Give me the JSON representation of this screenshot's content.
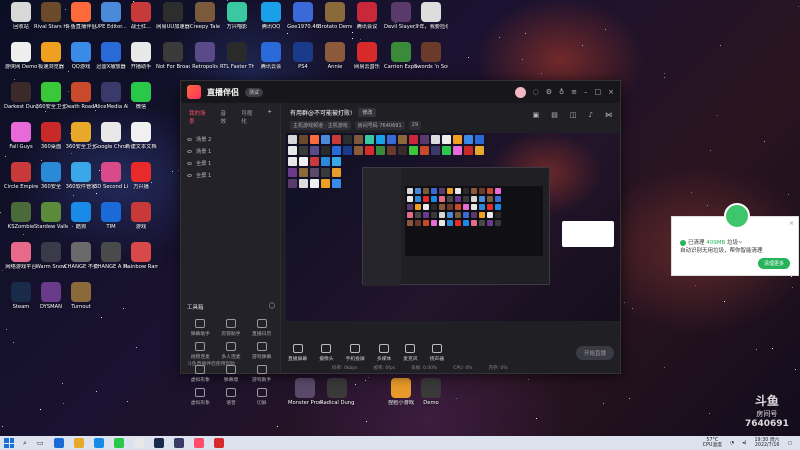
{
  "desktop_icons": [
    {
      "label": "回收站",
      "color": "#d8d8d8"
    },
    {
      "label": "Rival Stars Horse Ra...",
      "color": "#6a4a2a"
    },
    {
      "label": "斗鱼直播伴侣",
      "color": "#ff6a3d"
    },
    {
      "label": "UPE Editor...",
      "color": "#4a8ad8"
    },
    {
      "label": "战士红...",
      "color": "#c83a3a"
    },
    {
      "label": "网易UU加速器",
      "color": "#2d2d2d"
    },
    {
      "label": "Creepy Tale",
      "color": "#7a5a3a"
    },
    {
      "label": "万兴喵影",
      "color": "#3ac8a0"
    },
    {
      "label": "腾讯QQ",
      "color": "#1aa0e8"
    },
    {
      "label": "Gee1970.46",
      "color": "#3a6ad8"
    },
    {
      "label": "Brotato Demo",
      "color": "#8a6a3a"
    },
    {
      "label": "腾讯会议",
      "color": "#c8283a"
    },
    {
      "label": "Devil Slayer Raksasi",
      "color": "#5a3a6a"
    },
    {
      "label": "少年，我要捡垃圾",
      "color": "#ddd"
    },
    {
      "label": "游侠网 Demo",
      "color": "#eee"
    },
    {
      "label": "极速浏览器",
      "color": "#f0a020"
    },
    {
      "label": "QQ游戏",
      "color": "#3a8ae8"
    },
    {
      "label": "迅雷X播放器",
      "color": "#2a6ad8"
    },
    {
      "label": "开播助手",
      "color": "#e8e8e8"
    },
    {
      "label": "Not For Broadcast",
      "color": "#3a3a3a"
    },
    {
      "label": "Retropolis",
      "color": "#5a4a8a"
    },
    {
      "label": "RTL Faster Than Light",
      "color": "#2a2a2a"
    },
    {
      "label": "腾讯云会",
      "color": "#2a6ad8"
    },
    {
      "label": "PS4",
      "color": "#1a3a8a"
    },
    {
      "label": "Annie",
      "color": "#8a5a3a"
    },
    {
      "label": "网易云音乐",
      "color": "#d82a2a"
    },
    {
      "label": "Carrion Expedition",
      "color": "#3a8a3a"
    },
    {
      "label": "Swords 'n Souls Ne...",
      "color": "#6a3a2a"
    },
    {
      "label": "Darkest Dungeon",
      "color": "#3a2a2a"
    },
    {
      "label": "360安全卫士",
      "color": "#3ac83a"
    },
    {
      "label": "Death Road to Canada",
      "color": "#c84a2a"
    },
    {
      "label": "AliceMedia AIGCentral",
      "color": "#3a3a6a"
    },
    {
      "label": "微信",
      "color": "#2ac84a"
    },
    {
      "label": "Fall Guys",
      "color": "#e86ad8"
    },
    {
      "label": "360桌面",
      "color": "#c82a2a"
    },
    {
      "label": "360安全卫士",
      "color": "#e8a82a"
    },
    {
      "label": "Google Chrome",
      "color": "#e8e8e8"
    },
    {
      "label": "新建文本文档",
      "color": "#f0f0f0"
    },
    {
      "label": "Circle Empires",
      "color": "#c83a3a"
    },
    {
      "label": "360安全",
      "color": "#2a8ad8"
    },
    {
      "label": "360软件管家",
      "color": "#3aa8e8"
    },
    {
      "label": "3D Second Life",
      "color": "#d84a8a"
    },
    {
      "label": "万兴播",
      "color": "#e82a2a"
    },
    {
      "label": "KSZombie",
      "color": "#4a6a3a"
    },
    {
      "label": "Stardew Valley",
      "color": "#5a8a3a"
    },
    {
      "label": "酷狗",
      "color": "#1a8ae8"
    },
    {
      "label": "TIM",
      "color": "#1a6ad8"
    },
    {
      "label": "游戏",
      "color": "#c83a3a"
    },
    {
      "label": "网络游戏平台",
      "color": "#e86a8a"
    },
    {
      "label": "Warm Snow",
      "color": "#3a3a4a"
    },
    {
      "label": "CHANGE 不要可怜",
      "color": "#6a6a6a"
    },
    {
      "label": "CHANGE A Homeles...",
      "color": "#4a4a4a"
    },
    {
      "label": "Rainbow Rampage",
      "color": "#d84a4a"
    },
    {
      "label": "Steam",
      "color": "#1a2a4a"
    },
    {
      "label": "DYSMAN",
      "color": "#6a3a8a"
    },
    {
      "label": "Turnout",
      "color": "#8a6a3a"
    },
    {
      "label": "Monster Prom",
      "color": "#5a4a6a"
    },
    {
      "label": "Radical Dunge...",
      "color": "#3a3a3a"
    },
    {
      "label": "捏脸小游戏",
      "color": "#e89a2a"
    },
    {
      "label": "Demo",
      "color": "#3a3a3a"
    }
  ],
  "app": {
    "name": "直播伴侣",
    "badge": "测试",
    "sidebar_tabs": [
      "我的场景",
      "音效",
      "可视化"
    ],
    "scenes": [
      "场景 2",
      "场景 1",
      "全屏 1",
      "全屏 1"
    ],
    "tools_title": "工具箱",
    "tools": [
      "弹幕助手",
      "房管助手",
      "直播日历",
      "视频连麦",
      "多人连麦",
      "游戏弹幕",
      "虚拟形象",
      "弹幕墙",
      "游戏助手",
      "虚拟形象",
      "语音",
      "切屏"
    ],
    "sidebar_footer": "斗鱼直播伴侣使用帮助",
    "live_title": "有用群@不可能被打败!",
    "edit_label": "修改",
    "meta": [
      "主机游戏频道 · 主机游戏",
      "房间号码 7640691",
      "29"
    ],
    "bottom_controls": [
      "直播屏幕",
      "摄像头",
      "手机投屏",
      "多媒体",
      "麦克风",
      "扬声器"
    ],
    "start_label": "开始直播",
    "status": [
      "码率: 0kbps",
      "帧率: 0fps",
      "丢帧: 0.00%",
      "CPU: 0%",
      "内存: 0%"
    ]
  },
  "notification": {
    "line1_pre": "已清理",
    "line1_hl": "409MB",
    "line1_post": "垃圾~",
    "line2": "自动识别无用垃圾，帮你智能清理",
    "button": "清理更多",
    "close": "×"
  },
  "watermark": {
    "line1": "斗鱼",
    "line2": "房间号",
    "line3": "7640691"
  },
  "taskbar": {
    "weather": "57°C",
    "weather_sub": "CPU温度",
    "time": "19:30",
    "day": "周六",
    "date": "2022/7/16",
    "apps": [
      "#1a6ad8",
      "#e8a82a",
      "#1a8ae8",
      "#2ac84a",
      "#e8e8e8",
      "#1a2a4a",
      "#3a3a6a",
      "#ff4d6a",
      "#d82a2a"
    ]
  },
  "colors": {
    "accent": "#ff4d6a",
    "clean_green": "#27b35b"
  }
}
